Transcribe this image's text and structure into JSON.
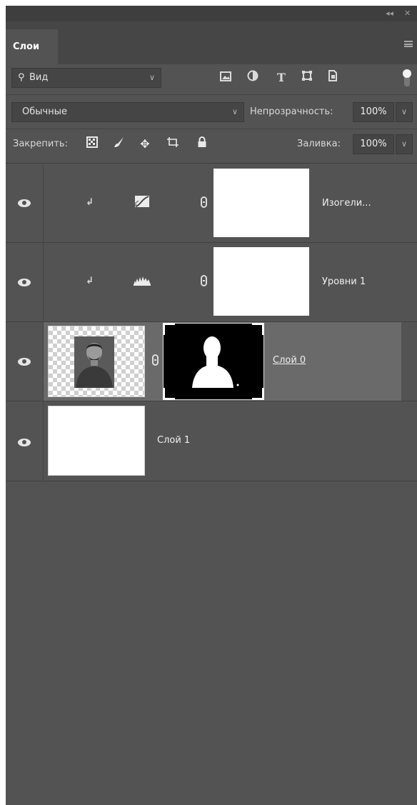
{
  "panel": {
    "title_buttons": {
      "collapse": "◂◂",
      "close": "✕"
    },
    "tab_label": "Слои"
  },
  "filter": {
    "label": "Вид",
    "icons": [
      "image-filter-icon",
      "adjustment-filter-icon",
      "type-filter-icon",
      "shape-filter-icon",
      "smart-object-filter-icon"
    ]
  },
  "blend": {
    "mode": "Обычные",
    "opacity_label": "Непрозрачность:",
    "opacity_value": "100%"
  },
  "lock": {
    "label": "Закрепить:",
    "icons": [
      "lock-transparent-pixels-icon",
      "lock-image-pixels-icon",
      "lock-position-icon",
      "lock-artboard-icon",
      "lock-all-icon"
    ],
    "fill_label": "Заливка:",
    "fill_value": "100%"
  },
  "layers": [
    {
      "name": "Изогели...",
      "type": "adjustment",
      "icon": "curves-adjustment-icon",
      "clipped": true,
      "visible": true,
      "selected": false
    },
    {
      "name": "Уровни 1",
      "type": "adjustment",
      "icon": "levels-adjustment-icon",
      "clipped": true,
      "visible": true,
      "selected": false
    },
    {
      "name": "Слой 0",
      "type": "pixel-with-mask",
      "clipped": false,
      "visible": true,
      "selected": true
    },
    {
      "name": "Слой 1",
      "type": "pixel",
      "clipped": false,
      "visible": true,
      "selected": false
    }
  ],
  "colors": {
    "panel_bg": "#535353",
    "tabbar_bg": "#464646",
    "selected_row": "#6a6a6a",
    "field_bg": "#454545"
  }
}
